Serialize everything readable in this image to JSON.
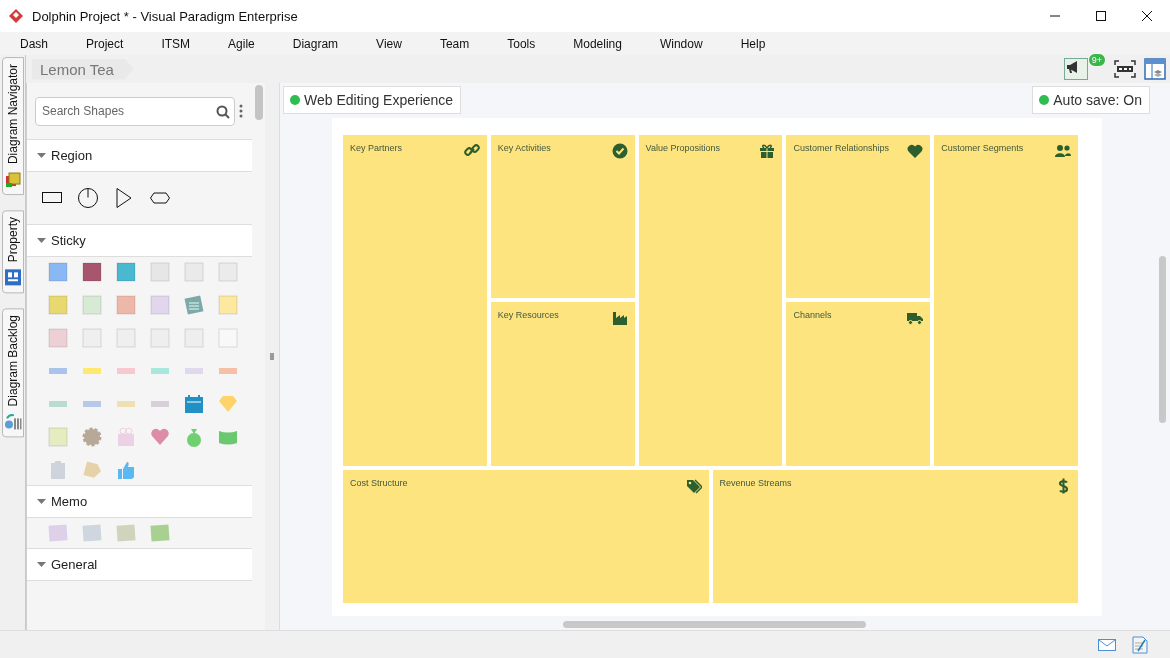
{
  "window": {
    "title": "Dolphin Project * - Visual Paradigm Enterprise"
  },
  "menu": [
    "Dash",
    "Project",
    "ITSM",
    "Agile",
    "Diagram",
    "View",
    "Team",
    "Tools",
    "Modeling",
    "Window",
    "Help"
  ],
  "side_tabs": [
    {
      "label": "Diagram Navigator"
    },
    {
      "label": "Property"
    },
    {
      "label": "Diagram Backlog"
    }
  ],
  "breadcrumb": [
    "Lemon Tea"
  ],
  "toolbar": {
    "notification_badge": "9+"
  },
  "palette": {
    "search": {
      "placeholder": "Search Shapes"
    },
    "sections": [
      {
        "title": "Region",
        "kind": "region"
      },
      {
        "title": "Sticky",
        "kind": "sticky"
      },
      {
        "title": "Memo",
        "kind": "memo"
      },
      {
        "title": "General",
        "kind": "general"
      }
    ]
  },
  "canvas": {
    "badges": [
      {
        "label": "Web Editing Experience"
      },
      {
        "label": "Auto save: On"
      }
    ],
    "blocks": [
      {
        "title": "Key Partners",
        "kind": "link"
      },
      {
        "title": "Key Activities",
        "kind": "check"
      },
      {
        "title": "Value Propositions",
        "kind": "gift"
      },
      {
        "title": "Customer Relationships",
        "kind": "heart"
      },
      {
        "title": "Customer Segments",
        "kind": "users"
      },
      {
        "title": "Key Resources",
        "kind": "factory"
      },
      {
        "title": "Channels",
        "kind": "truck"
      },
      {
        "title": "Cost Structure",
        "kind": "tags"
      },
      {
        "title": "Revenue Streams",
        "kind": "dollar"
      }
    ]
  }
}
